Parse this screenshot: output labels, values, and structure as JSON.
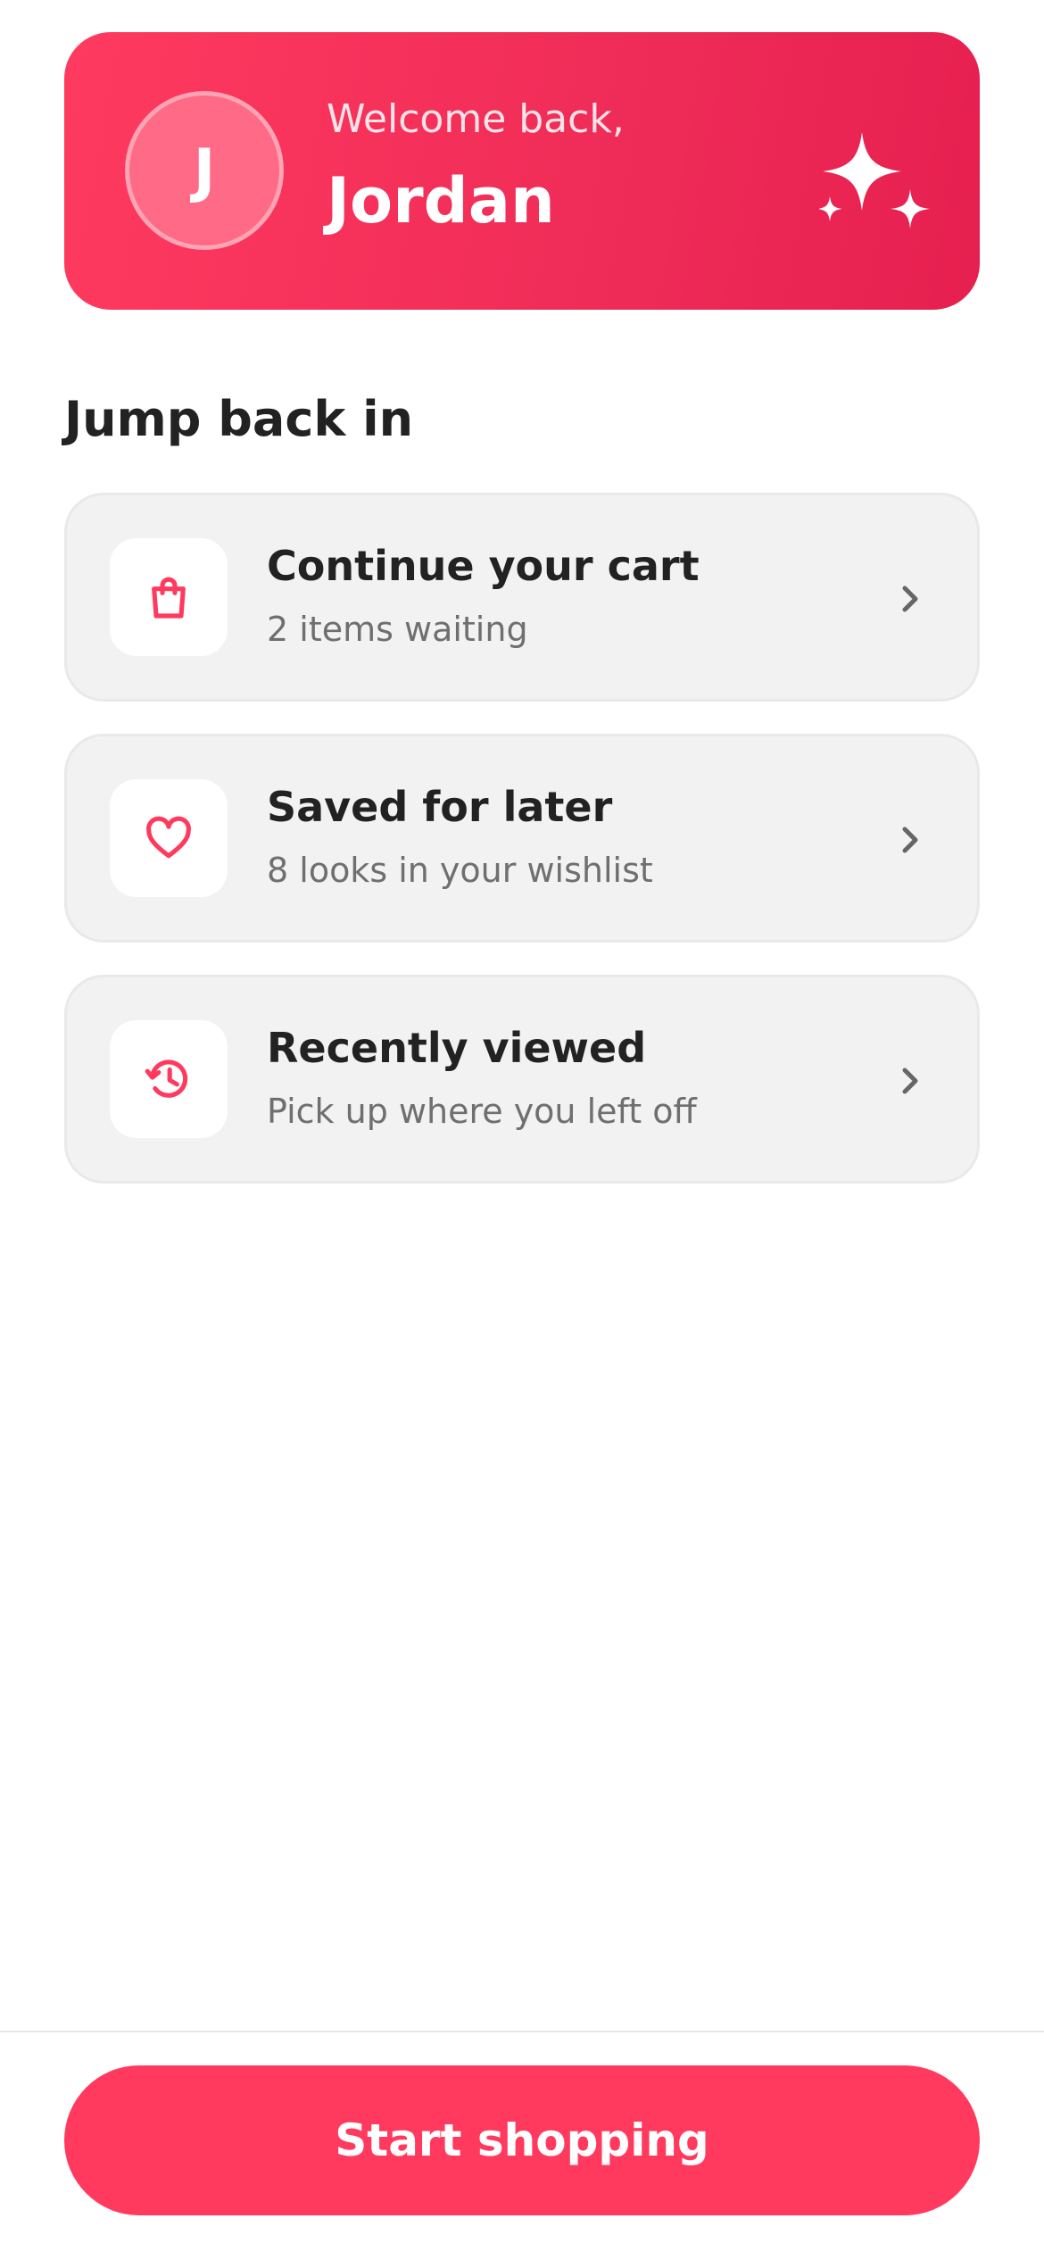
{
  "colors": {
    "accent": "#ff3a5e",
    "card_background": "#f2f2f2",
    "title_text": "#222222",
    "muted_text": "#6f6f6f"
  },
  "welcome": {
    "avatar_initial": "J",
    "greeting": "Welcome back,",
    "name": "Jordan",
    "decoration_icon": "sparkles-icon"
  },
  "section": {
    "title": "Jump back in"
  },
  "cards": [
    {
      "icon": "shopping-bag-icon",
      "title": "Continue your cart",
      "subtitle": "2 items waiting"
    },
    {
      "icon": "heart-icon",
      "title": "Saved for later",
      "subtitle": "8 looks in your wishlist"
    },
    {
      "icon": "history-icon",
      "title": "Recently viewed",
      "subtitle": "Pick up where you left off"
    }
  ],
  "cta": {
    "label": "Start shopping"
  }
}
